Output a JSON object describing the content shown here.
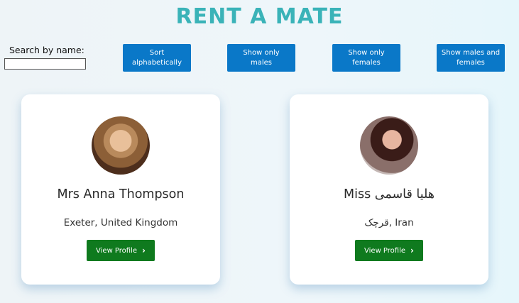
{
  "page": {
    "title": "RENT A MATE"
  },
  "search": {
    "label": "Search by name:",
    "value": "",
    "placeholder": ""
  },
  "controls": {
    "sort_label": "Sort alphabetically",
    "males_label": "Show only males",
    "females_label": "Show only females",
    "both_label": "Show males and females"
  },
  "profiles": [
    {
      "name": "Mrs Anna Thompson",
      "location": "Exeter, United Kingdom",
      "button_label": "View Profile",
      "button_icon": "chevron-right-icon"
    },
    {
      "name": "Miss هلیا قاسمی",
      "location": "قرچک, Iran",
      "button_label": "View Profile",
      "button_icon": "chevron-right-icon"
    }
  ],
  "colors": {
    "title": "#3ab3b8",
    "primary_button": "#0a78c8",
    "view_button": "#0f7a1e"
  }
}
